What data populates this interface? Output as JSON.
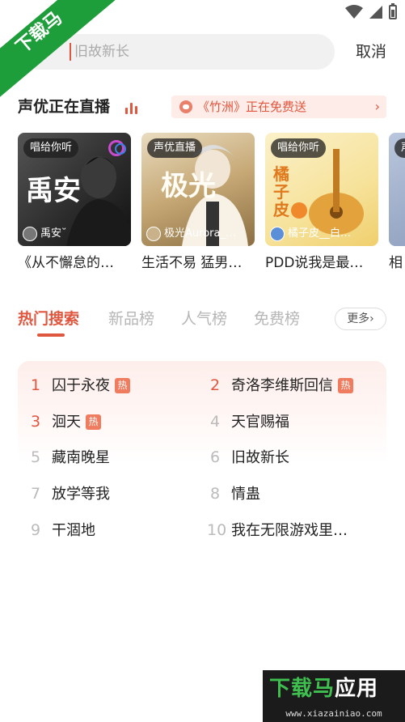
{
  "watermark": {
    "ribbon_text": "下载马",
    "brand_green": "下载马",
    "brand_white": "应用",
    "url": "www.xiazainiao.com"
  },
  "search": {
    "placeholder": "旧故新长",
    "cancel_label": "取消"
  },
  "live": {
    "title": "声优正在直播",
    "promo_text": "《竹洲》正在免费送",
    "promo_arrow": "›",
    "cards": [
      {
        "tag": "唱给你听",
        "host": "禹安˘",
        "caption": "《从不懈怠的…",
        "art_text": "禹安"
      },
      {
        "tag": "声优直播",
        "host": "极光Aurora_…",
        "caption": "生活不易 猛男…",
        "art_text": "极光"
      },
      {
        "tag": "唱给你听",
        "host": "橘子皮__白…",
        "caption": "PDD说我是最…",
        "art_text": "橘子皮"
      },
      {
        "tag": "声",
        "host": "",
        "caption": "相",
        "art_text": ""
      }
    ]
  },
  "tabs": {
    "items": [
      "热门搜索",
      "新品榜",
      "人气榜",
      "免费榜"
    ],
    "active_index": 0,
    "more_label": "更多›"
  },
  "hot": {
    "badge": "热",
    "items": [
      {
        "rank": "1",
        "label": "囚于永夜",
        "hot": true
      },
      {
        "rank": "2",
        "label": "奇洛李维斯回信",
        "hot": true
      },
      {
        "rank": "3",
        "label": "洄天",
        "hot": true
      },
      {
        "rank": "4",
        "label": "天官赐福",
        "hot": false
      },
      {
        "rank": "5",
        "label": "藏南晚星",
        "hot": false
      },
      {
        "rank": "6",
        "label": "旧故新长",
        "hot": false
      },
      {
        "rank": "7",
        "label": "放学等我",
        "hot": false
      },
      {
        "rank": "8",
        "label": "情蛊",
        "hot": false
      },
      {
        "rank": "9",
        "label": "干涸地",
        "hot": false
      },
      {
        "rank": "10",
        "label": "我在无限游戏里…",
        "hot": false
      }
    ]
  },
  "colors": {
    "accent": "#e0573f",
    "badge": "#f07c5f",
    "watermark_green": "#1e9e3a"
  }
}
